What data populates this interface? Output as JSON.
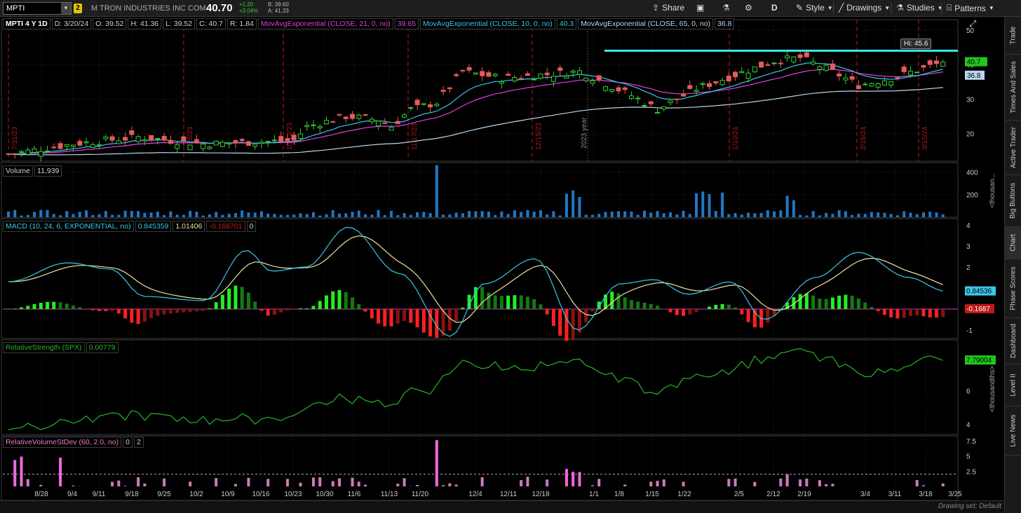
{
  "header": {
    "symbol": "MPTI",
    "badge": "2",
    "company": "M TRON INDUSTRIES INC COM",
    "last": "40.70",
    "change": "+1.20",
    "change_pct": "+3.04%",
    "bid": "B: 39.60",
    "ask": "A: 41.33",
    "buttons": {
      "share": "Share",
      "period": "D",
      "style": "Style",
      "drawings": "Drawings",
      "studies": "Studies",
      "patterns": "Patterns"
    }
  },
  "right_tabs": [
    "Trade",
    "Times And Sales",
    "Active Trader",
    "Big Buttons",
    "Chart",
    "Phase Scores",
    "Dashboard",
    "Level II",
    "Live News"
  ],
  "price_legend": {
    "title": "MPTI 4 Y 1D",
    "date": "D: 3/20/24",
    "open": "O: 39.52",
    "high": "H: 41.36",
    "low": "L: 39.52",
    "close": "C: 40.7",
    "range": "R: 1.84",
    "ema21_label": "MovAvgExponential (CLOSE, 21, 0, no)",
    "ema21_value": "39.65",
    "ema10_label": "MovAvgExponential (CLOSE, 10, 0, no)",
    "ema10_value": "40.3",
    "ema65_label": "MovAvgExponential (CLOSE, 65, 0, no)",
    "ema65_value": "36.8"
  },
  "volume_legend": {
    "label": "Volume",
    "value": "11,939"
  },
  "macd_legend": {
    "label": "MACD (10, 24, 6, EXPONENTIAL, no)",
    "value": "0.845359",
    "avg": "1.01406",
    "diff": "-0.168701",
    "zero": "0"
  },
  "rs_legend": {
    "label": "RelativeStrength (SPX)",
    "value": "0.00779"
  },
  "rvs_legend": {
    "label": "RelativeVolumeStDev (60, 2.0, no)",
    "v1": "0",
    "v2": "2"
  },
  "hi_label": "Hi: 45.6",
  "drawing_set": "Drawing set: Default",
  "chart_data": {
    "type": "candlestick",
    "x_ticks": [
      "8/28",
      "9/4",
      "9/11",
      "9/18",
      "9/25",
      "10/2",
      "10/9",
      "10/16",
      "10/23",
      "10/30",
      "11/6",
      "11/13",
      "11/20",
      "12/4",
      "12/11",
      "12/18",
      "1/1",
      "1/8",
      "1/15",
      "1/22",
      "2/5",
      "2/12",
      "2/19",
      "3/4",
      "3/11",
      "3/18",
      "3/25"
    ],
    "event_dates": [
      "7/31/23",
      "9/15/23",
      "10/12/23",
      "11/17/23",
      "12/15/23",
      "1/10/24",
      "2/16/24",
      "3/15/24"
    ],
    "year_marker": "2023 year",
    "price": {
      "y_ticks": [
        20,
        30,
        40,
        50
      ],
      "ylim": [
        12,
        53
      ],
      "resistance": 44.0,
      "hi": 45.6,
      "last_close": "40.7",
      "ema65_last": "36.8"
    },
    "volume": {
      "unit": "<thousan...",
      "y_ticks": [
        200,
        400
      ]
    },
    "macd": {
      "y_ticks": [
        -1,
        1,
        2,
        3,
        4
      ],
      "ylim": [
        -1.4,
        4.3
      ],
      "last_value": "0.84536",
      "last_diff": "-0.1687"
    },
    "rs": {
      "unit": "<thousandths>",
      "y_ticks": [
        4,
        6
      ],
      "ylim": [
        3.4,
        9.0
      ],
      "last_value": "7.79004"
    },
    "rvs": {
      "y_ticks": [
        2.5,
        5,
        7.5
      ],
      "ylim": [
        0,
        8.3
      ],
      "threshold": 2.0
    },
    "colors": {
      "up": "#33cc33",
      "down": "#e85a5a",
      "ema10": "#38c8e8",
      "ema21": "#e040e0",
      "ema65": "#b8d8f0",
      "resistance": "#3de8e8",
      "volume": "#1e78c8",
      "macd": "#38c8e8",
      "macd_avg": "#f0e0a0",
      "rs": "#28b428",
      "rvs": "#f078c8",
      "event_line": "#c01818"
    }
  }
}
